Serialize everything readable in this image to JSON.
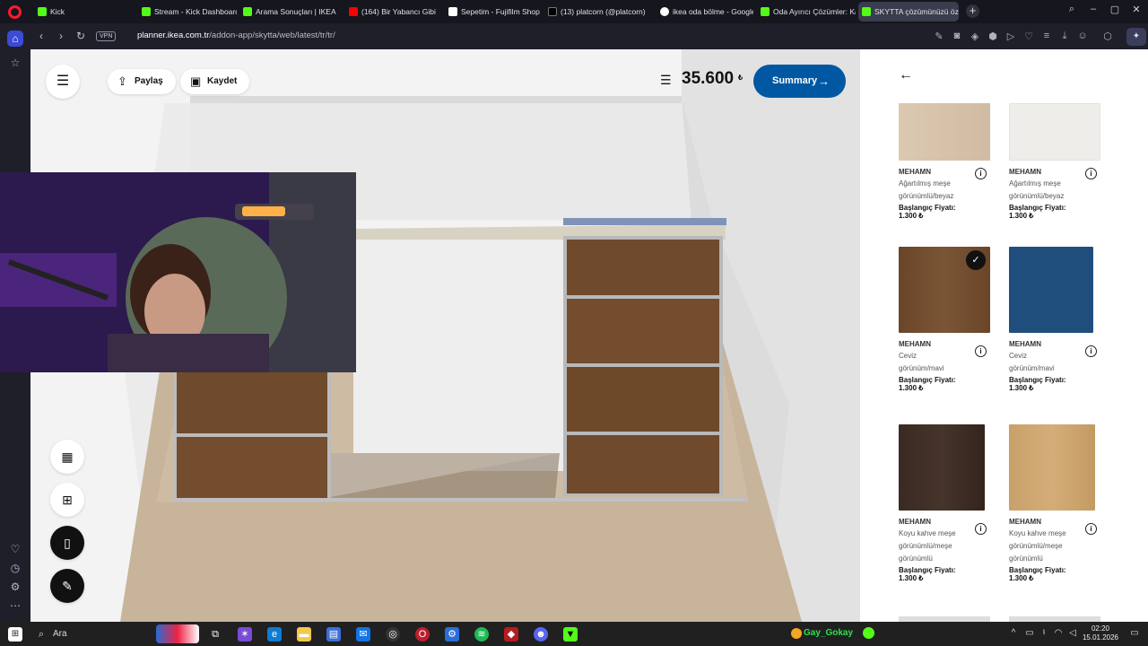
{
  "browser": {
    "tabs": [
      {
        "label": "Kick",
        "color": "#53fc18"
      },
      {
        "label": "Stream - Kick Dashboard",
        "color": "#53fc18"
      },
      {
        "label": "Arama Sonuçları | IKEA",
        "color": "#53fc18"
      },
      {
        "label": "(164) Bir Yabancı Gibi",
        "color": "#ff0000"
      },
      {
        "label": "Sepetim - Fujifilm Shop",
        "color": "#ffffff"
      },
      {
        "label": "(13) platcorn (@platcorn)",
        "color": "#000000"
      },
      {
        "label": "ikea oda bölme - Google",
        "color": "#ffffff"
      },
      {
        "label": "Oda Ayırıcı Çözümler: Kay",
        "color": "#53fc18"
      },
      {
        "label": "SKYTTA çözümünüzü öze",
        "color": "#53fc18"
      }
    ],
    "url_host": "planner.ikea.com.tr",
    "url_path": "/addon-app/skytta/web/latest/tr/tr/",
    "vpn_label": "VPN",
    "ai_label": "AI"
  },
  "toolbar": {
    "share_label": "Paylaş",
    "save_label": "Kaydet",
    "price": "35.600",
    "currency": "₺",
    "summary_label": "Summary"
  },
  "products": [
    {
      "brand": "MEHAMN",
      "desc": "Ağartılmış meşe görünümlü/beyaz",
      "price_label": "Başlangıç Fiyatı:",
      "price": "1.300 ₺",
      "color": "#d9c6ad",
      "selected": false
    },
    {
      "brand": "MEHAMN",
      "desc": "Ağartılmış meşe görünümlü/beyaz",
      "price_label": "Başlangıç Fiyatı:",
      "price": "1.300 ₺",
      "color": "#ecebe7",
      "selected": false
    },
    {
      "brand": "MEHAMN",
      "desc": "Ceviz görünüm/mavi",
      "price_label": "Başlangıç Fiyatı:",
      "price": "1.300 ₺",
      "color": "#6e4a2b",
      "selected": true
    },
    {
      "brand": "MEHAMN",
      "desc": "Ceviz görünüm/mavi",
      "price_label": "Başlangıç Fiyatı:",
      "price": "1.300 ₺",
      "color": "#1f4e7c",
      "selected": false
    },
    {
      "brand": "MEHAMN",
      "desc": "Koyu kahve meşe görünümlü/meşe görünümlü",
      "price_label": "Başlangıç Fiyatı:",
      "price": "1.300 ₺",
      "color": "#3a2a22",
      "selected": false
    },
    {
      "brand": "MEHAMN",
      "desc": "Koyu kahve meşe görünümlü/meşe görünümlü",
      "price_label": "Başlangıç Fiyatı:",
      "price": "1.300 ₺",
      "color": "#c8a06b",
      "selected": false
    }
  ],
  "taskbar": {
    "search_label": "Ara",
    "user": "Gay_Gokay",
    "time": "02:20",
    "date": "15.01.2026"
  }
}
